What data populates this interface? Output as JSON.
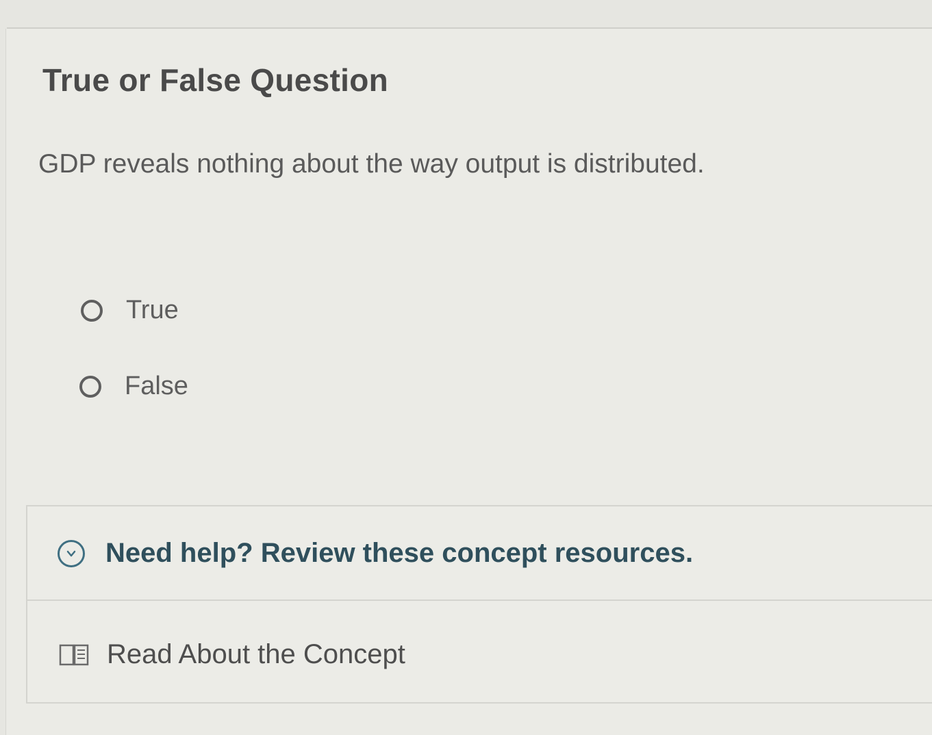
{
  "question_card": {
    "title": "True or False Question",
    "prompt": "GDP reveals nothing about the way output is distributed."
  },
  "options": [
    {
      "label": "True",
      "selected": false
    },
    {
      "label": "False",
      "selected": false
    }
  ],
  "help": {
    "toggle_label": "Need help? Review these concept resources.",
    "resource_label": "Read About the Concept",
    "toggle_icon": "chevron-down-icon",
    "resource_icon": "book-icon",
    "accent_color": "#2f4f5c"
  }
}
